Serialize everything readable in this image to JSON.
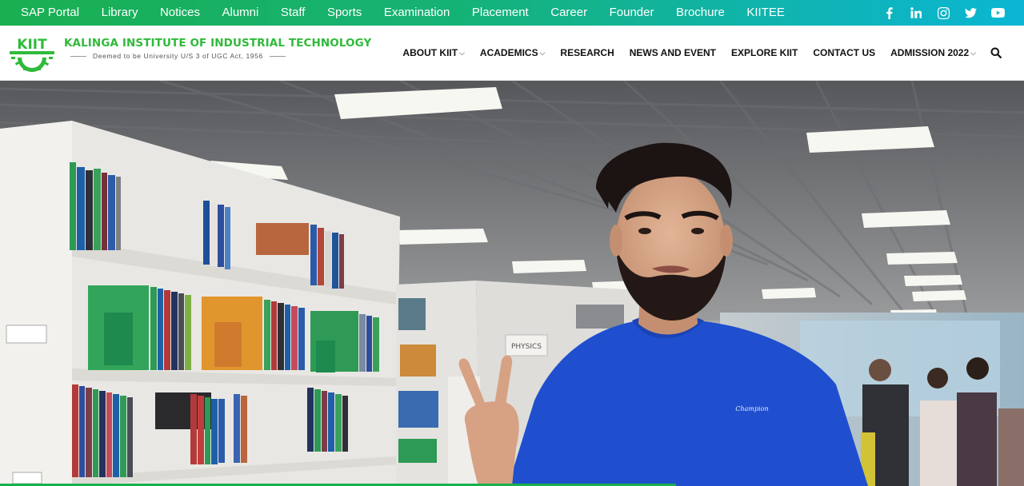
{
  "topbar": {
    "links": [
      "SAP Portal",
      "Library",
      "Notices",
      "Alumni",
      "Staff",
      "Sports",
      "Examination",
      "Placement",
      "Career",
      "Founder",
      "Brochure",
      "KIITEE"
    ],
    "social": [
      "facebook-icon",
      "linkedin-icon",
      "instagram-icon",
      "twitter-icon",
      "youtube-icon"
    ]
  },
  "logo": {
    "mark": "KIIT",
    "title": "KALINGA INSTITUTE OF INDUSTRIAL TECHNOLOGY",
    "subtitle": "Deemed to be University U/S 3 of UGC Act, 1956"
  },
  "nav": {
    "items": [
      {
        "label": "ABOUT KIIT",
        "dropdown": true
      },
      {
        "label": "ACADEMICS",
        "dropdown": true
      },
      {
        "label": "RESEARCH",
        "dropdown": false
      },
      {
        "label": "NEWS AND EVENT",
        "dropdown": false
      },
      {
        "label": "EXPLORE KIIT",
        "dropdown": false
      },
      {
        "label": "CONTACT US",
        "dropdown": false
      },
      {
        "label": "ADMISSION 2022",
        "dropdown": true
      }
    ],
    "chevron": "⌄"
  },
  "hero": {
    "shelf_labels": [
      "PHYSICS"
    ],
    "shirt_logo": "Champion"
  },
  "colors": {
    "topbar_start": "#1aaf50",
    "topbar_end": "#0ab6d3",
    "brand_green": "#2fba3a",
    "shirt_blue": "#1f4fcf"
  }
}
